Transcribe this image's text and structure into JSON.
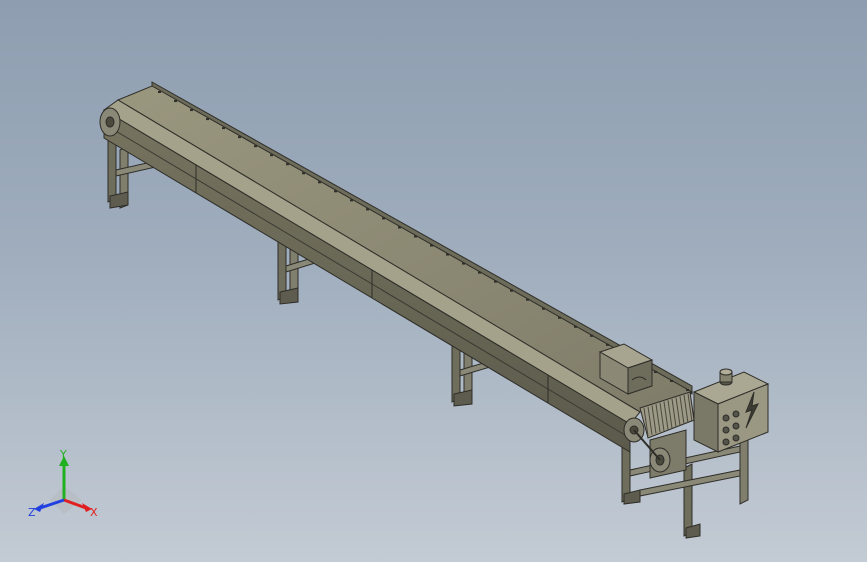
{
  "viewport": {
    "background_top": "#8e9eb0",
    "background_bottom": "#c3cbd4"
  },
  "model": {
    "description_icon": "conveyor-3d-model",
    "frame_color": "#7c7a6a",
    "belt_color": "#8d8a78",
    "edge_color": "#2e2d28"
  },
  "triad": {
    "x_label": "X",
    "y_label": "Y",
    "z_label": "Z",
    "x_color": "#e02020",
    "y_color": "#20b020",
    "z_color": "#2040e0"
  }
}
